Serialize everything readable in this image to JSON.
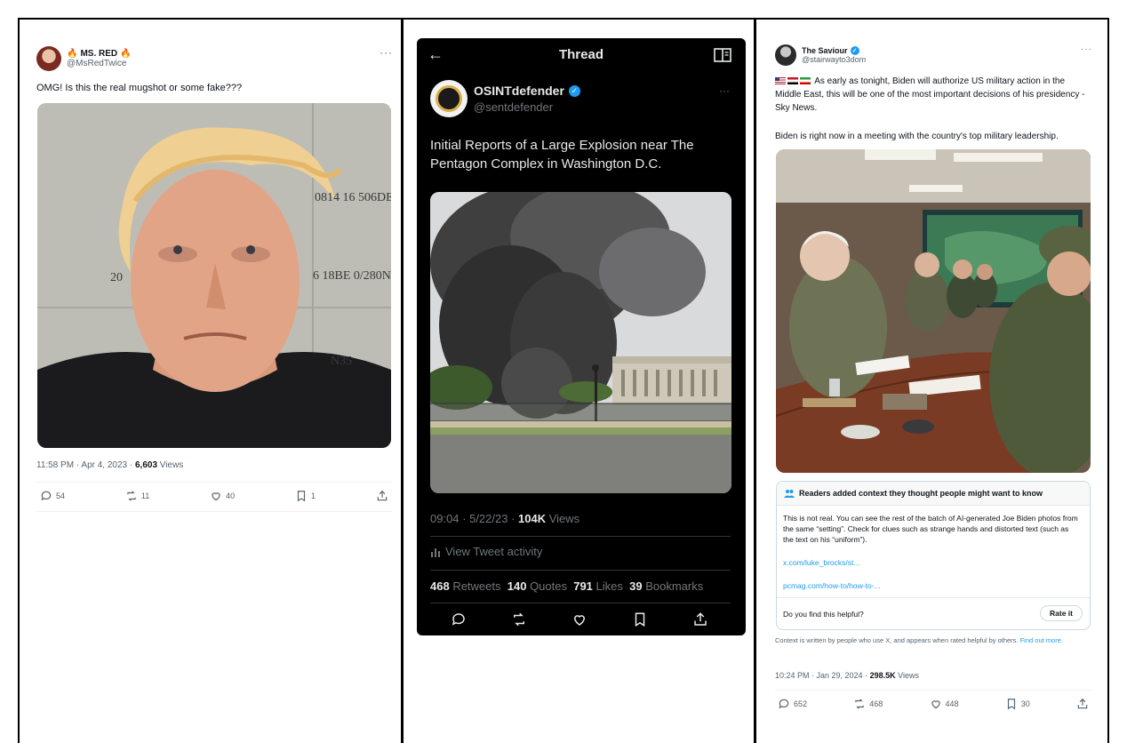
{
  "tweet1": {
    "display_name": "MS. RED",
    "handle": "@MsRedTwice",
    "more": "···",
    "text": "OMG! Is this the real mugshot or some fake???",
    "image_text": {
      "top_right": "0814 16 506DE",
      "mid_left": "20",
      "mid_right": "6 18BE 0/280ND",
      "bottom_right": "N35"
    },
    "timestamp": "11:58 PM · Apr 4, 2023 · ",
    "views_count": "6,603",
    "views_label": " Views",
    "replies": "54",
    "retweets": "11",
    "likes": "40",
    "bookmarks": "1"
  },
  "tweet2": {
    "header_title": "Thread",
    "display_name": "OSINTdefender",
    "handle": "@sentdefender",
    "more": "···",
    "text": "Initial Reports of a Large Explosion near The Pentagon Complex in Washington D.C.",
    "timestamp": "09:04 · 5/22/23 · ",
    "views_count": "104K",
    "views_label": " Views",
    "activity_label": "View Tweet activity",
    "stats": [
      {
        "value": "468",
        "label": " Retweets"
      },
      {
        "value": "140",
        "label": " Quotes"
      },
      {
        "value": "791",
        "label": " Likes"
      },
      {
        "value": "39",
        "label": " Bookmarks"
      }
    ]
  },
  "tweet3": {
    "display_name": "The Saviour",
    "handle": "@stairwayto3dom",
    "more": "···",
    "text1": "As early as tonight, Biden will authorize US military action in the Middle East, this will be one of the most important decisions of his presidency - Sky News.",
    "text2": "Biden is right now in a meeting with the country's top military leadership.",
    "note_title": "Readers added context they thought people might want to know",
    "note_body": "This is not real. You can see the rest of the batch of AI-generated Joe Biden photos from the same “setting”. Check for clues such as strange hands and distorted text (such as the text on his “uniform”).",
    "link1": "x.com/luke_brocks/st...",
    "link2": "pcmag.com/how-to/how-to-...",
    "helpful_question": "Do you find this helpful?",
    "rate_label": "Rate it",
    "disclaimer": "Context is written by people who use X, and appears when rated helpful by others.",
    "find_out": "Find out more.",
    "timestamp": "10:24 PM · Jan 29, 2024 · ",
    "views_count": "298.5K",
    "views_label": " Views",
    "replies": "652",
    "retweets": "468",
    "likes": "448",
    "bookmarks": "30"
  },
  "colors": {
    "accent": "#1d9bf0",
    "dark_bg": "#000000",
    "text": "#0f1419",
    "muted": "#536471"
  }
}
